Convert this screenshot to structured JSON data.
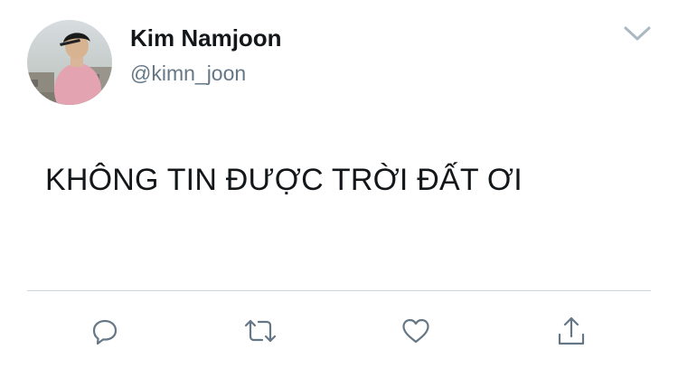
{
  "tweet": {
    "author": {
      "display_name": "Kim Namjoon",
      "handle": "@kimn_joon",
      "avatar_icon": "profile-photo"
    },
    "text": "KHÔNG TIN ĐƯỢC TRỜI ĐẤT ƠI",
    "menu_icon": "chevron-down-icon",
    "actions": [
      {
        "name": "reply",
        "icon": "reply-bubble-icon"
      },
      {
        "name": "retweet",
        "icon": "retweet-icon"
      },
      {
        "name": "like",
        "icon": "heart-icon"
      },
      {
        "name": "share",
        "icon": "share-icon"
      }
    ]
  },
  "colors": {
    "text": "#14171a",
    "secondary_text": "#657786",
    "icon": "#657786",
    "divider": "#ccd6dd"
  }
}
